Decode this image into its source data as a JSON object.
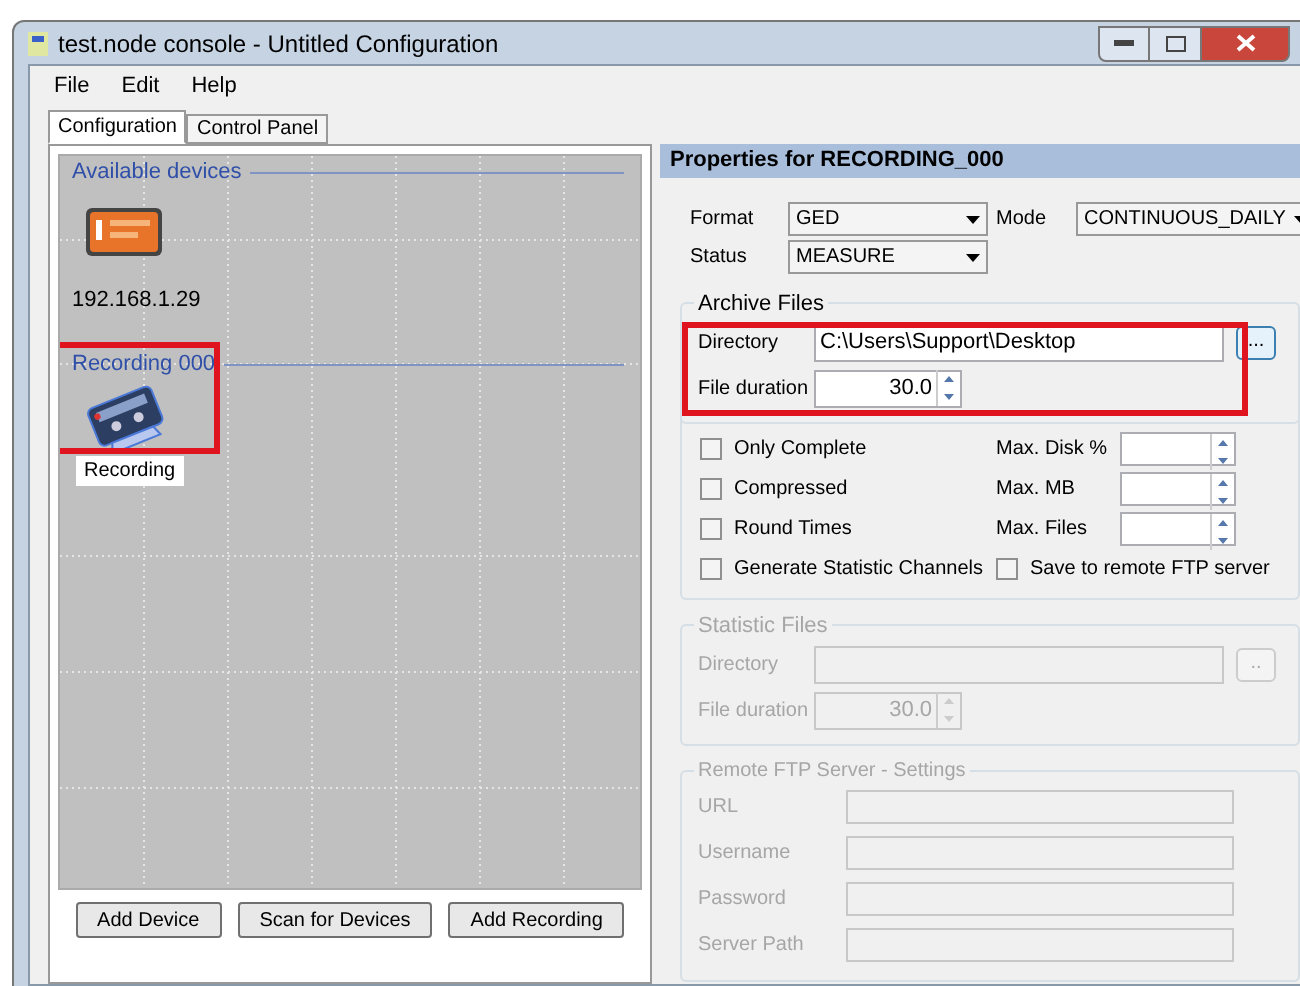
{
  "window": {
    "title": "test.node console - Untitled Configuration"
  },
  "menu": [
    "File",
    "Edit",
    "Help"
  ],
  "tabs": [
    {
      "label": "Configuration",
      "selected": true
    },
    {
      "label": "Control Panel",
      "selected": false
    }
  ],
  "canvas": {
    "groups": [
      {
        "title": "Available devices",
        "items": [
          {
            "kind": "device",
            "label": "192.168.1.29"
          }
        ]
      },
      {
        "title": "Recording 000",
        "items": [
          {
            "kind": "recording",
            "label": "Recording"
          }
        ]
      }
    ],
    "buttons": [
      "Add Device",
      "Scan for Devices",
      "Add Recording"
    ]
  },
  "properties": {
    "title": "Properties for RECORDING_000",
    "selectors": [
      {
        "label": "Format",
        "value": "GED"
      },
      {
        "label": "Mode",
        "value": "CONTINUOUS_DAILY"
      },
      {
        "label": "Status",
        "value": "MEASURE"
      }
    ],
    "archive_files": {
      "title": "Archive Files",
      "disabled": false,
      "directory_label": "Directory",
      "directory": "C:\\Users\\Support\\Desktop",
      "browse": "...",
      "duration_label": "File duration",
      "duration": "30.0"
    },
    "option_rows": [
      [
        {
          "kind": "checkbox",
          "label": "Only Complete",
          "checked": false
        },
        {
          "kind": "spinner",
          "label": "Max. Disk %"
        }
      ],
      [
        {
          "kind": "checkbox",
          "label": "Compressed",
          "checked": false
        },
        {
          "kind": "spinner",
          "label": "Max. MB"
        }
      ],
      [
        {
          "kind": "checkbox",
          "label": "Round Times",
          "checked": false
        },
        {
          "kind": "spinner",
          "label": "Max. Files"
        }
      ],
      [
        {
          "kind": "checkbox",
          "label": "Generate Statistic Channels",
          "checked": false
        },
        {
          "kind": "checkbox",
          "label": "Save to remote FTP server",
          "checked": false
        }
      ]
    ],
    "statistic_files": {
      "title": "Statistic Files",
      "disabled": true,
      "directory_label": "Directory",
      "browse": "..",
      "duration_label": "File duration",
      "duration": "30.0"
    },
    "ftp": {
      "title": "Remote FTP Server - Settings",
      "disabled": true,
      "fields": [
        {
          "label": "URL"
        },
        {
          "label": "Username"
        },
        {
          "label": "Password"
        },
        {
          "label": "Server Path"
        }
      ]
    }
  }
}
